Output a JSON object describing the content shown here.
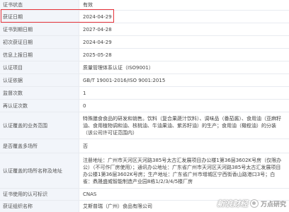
{
  "rows": [
    {
      "label": "证书状态",
      "value": "有效"
    },
    {
      "label": "获证日期",
      "value": "2024-04-29"
    },
    {
      "label": "证书到期日期",
      "value": "2027-04-28"
    },
    {
      "label": "初次获证日期",
      "value": "2024-04-29"
    },
    {
      "label": "信息上报日期",
      "value": "2025-05-28"
    },
    {
      "label": "认证项目",
      "value": "质量管理体系认证（ISO9001）"
    },
    {
      "label": "认证依据",
      "value": "GB/T 19001-2016/ISO 9001:2015"
    },
    {
      "label": "监督次数",
      "value": "1"
    },
    {
      "label": "再认证次数",
      "value": "0"
    },
    {
      "label": "认证覆盖的业务范围",
      "value": "特殊膳食食品的研发和销售。饮料（复合果蔬汁饮料）、调味品（番茄酱）、食用油（亚麻籽油、食用植物调和油、核桃油、牛油果油、紫苏籽油）的生产；食用油（橄榄油）的分装（该公司许可证范围内）"
    },
    {
      "label": "是否覆盖多场所",
      "value": "否"
    },
    {
      "label": "认证覆盖的场所名称及地址",
      "value": "注册地址：广州市天河区天河路385号太古汇发展项目办公楼1第36层3602K号房（仅限办公）（不可作厂房使用）；通讯办公地址：广东省广州市天河区天河路385号太古汇发展项目办公楼1第36层3602K号房；生产地址：广东省广州市增城区宁西街香山路港口3号；白雀：鼎晟盛威智能制造产业园8栋1/2/3/4/5楼厂房"
    },
    {
      "label": "证书使用的认可标识",
      "value": "CNAS"
    },
    {
      "label": "获证组织名称",
      "value": "艾斯普瑞（广州）食品有限公司"
    }
  ],
  "watermark": {
    "logo": "新浪财经",
    "text": "万点研究"
  },
  "colors": {
    "highlight": "#e8343b",
    "label_bg": "#f2f5fa",
    "border": "#e8ebf0"
  },
  "icons": {
    "watermark_circle": "circle-icon"
  }
}
